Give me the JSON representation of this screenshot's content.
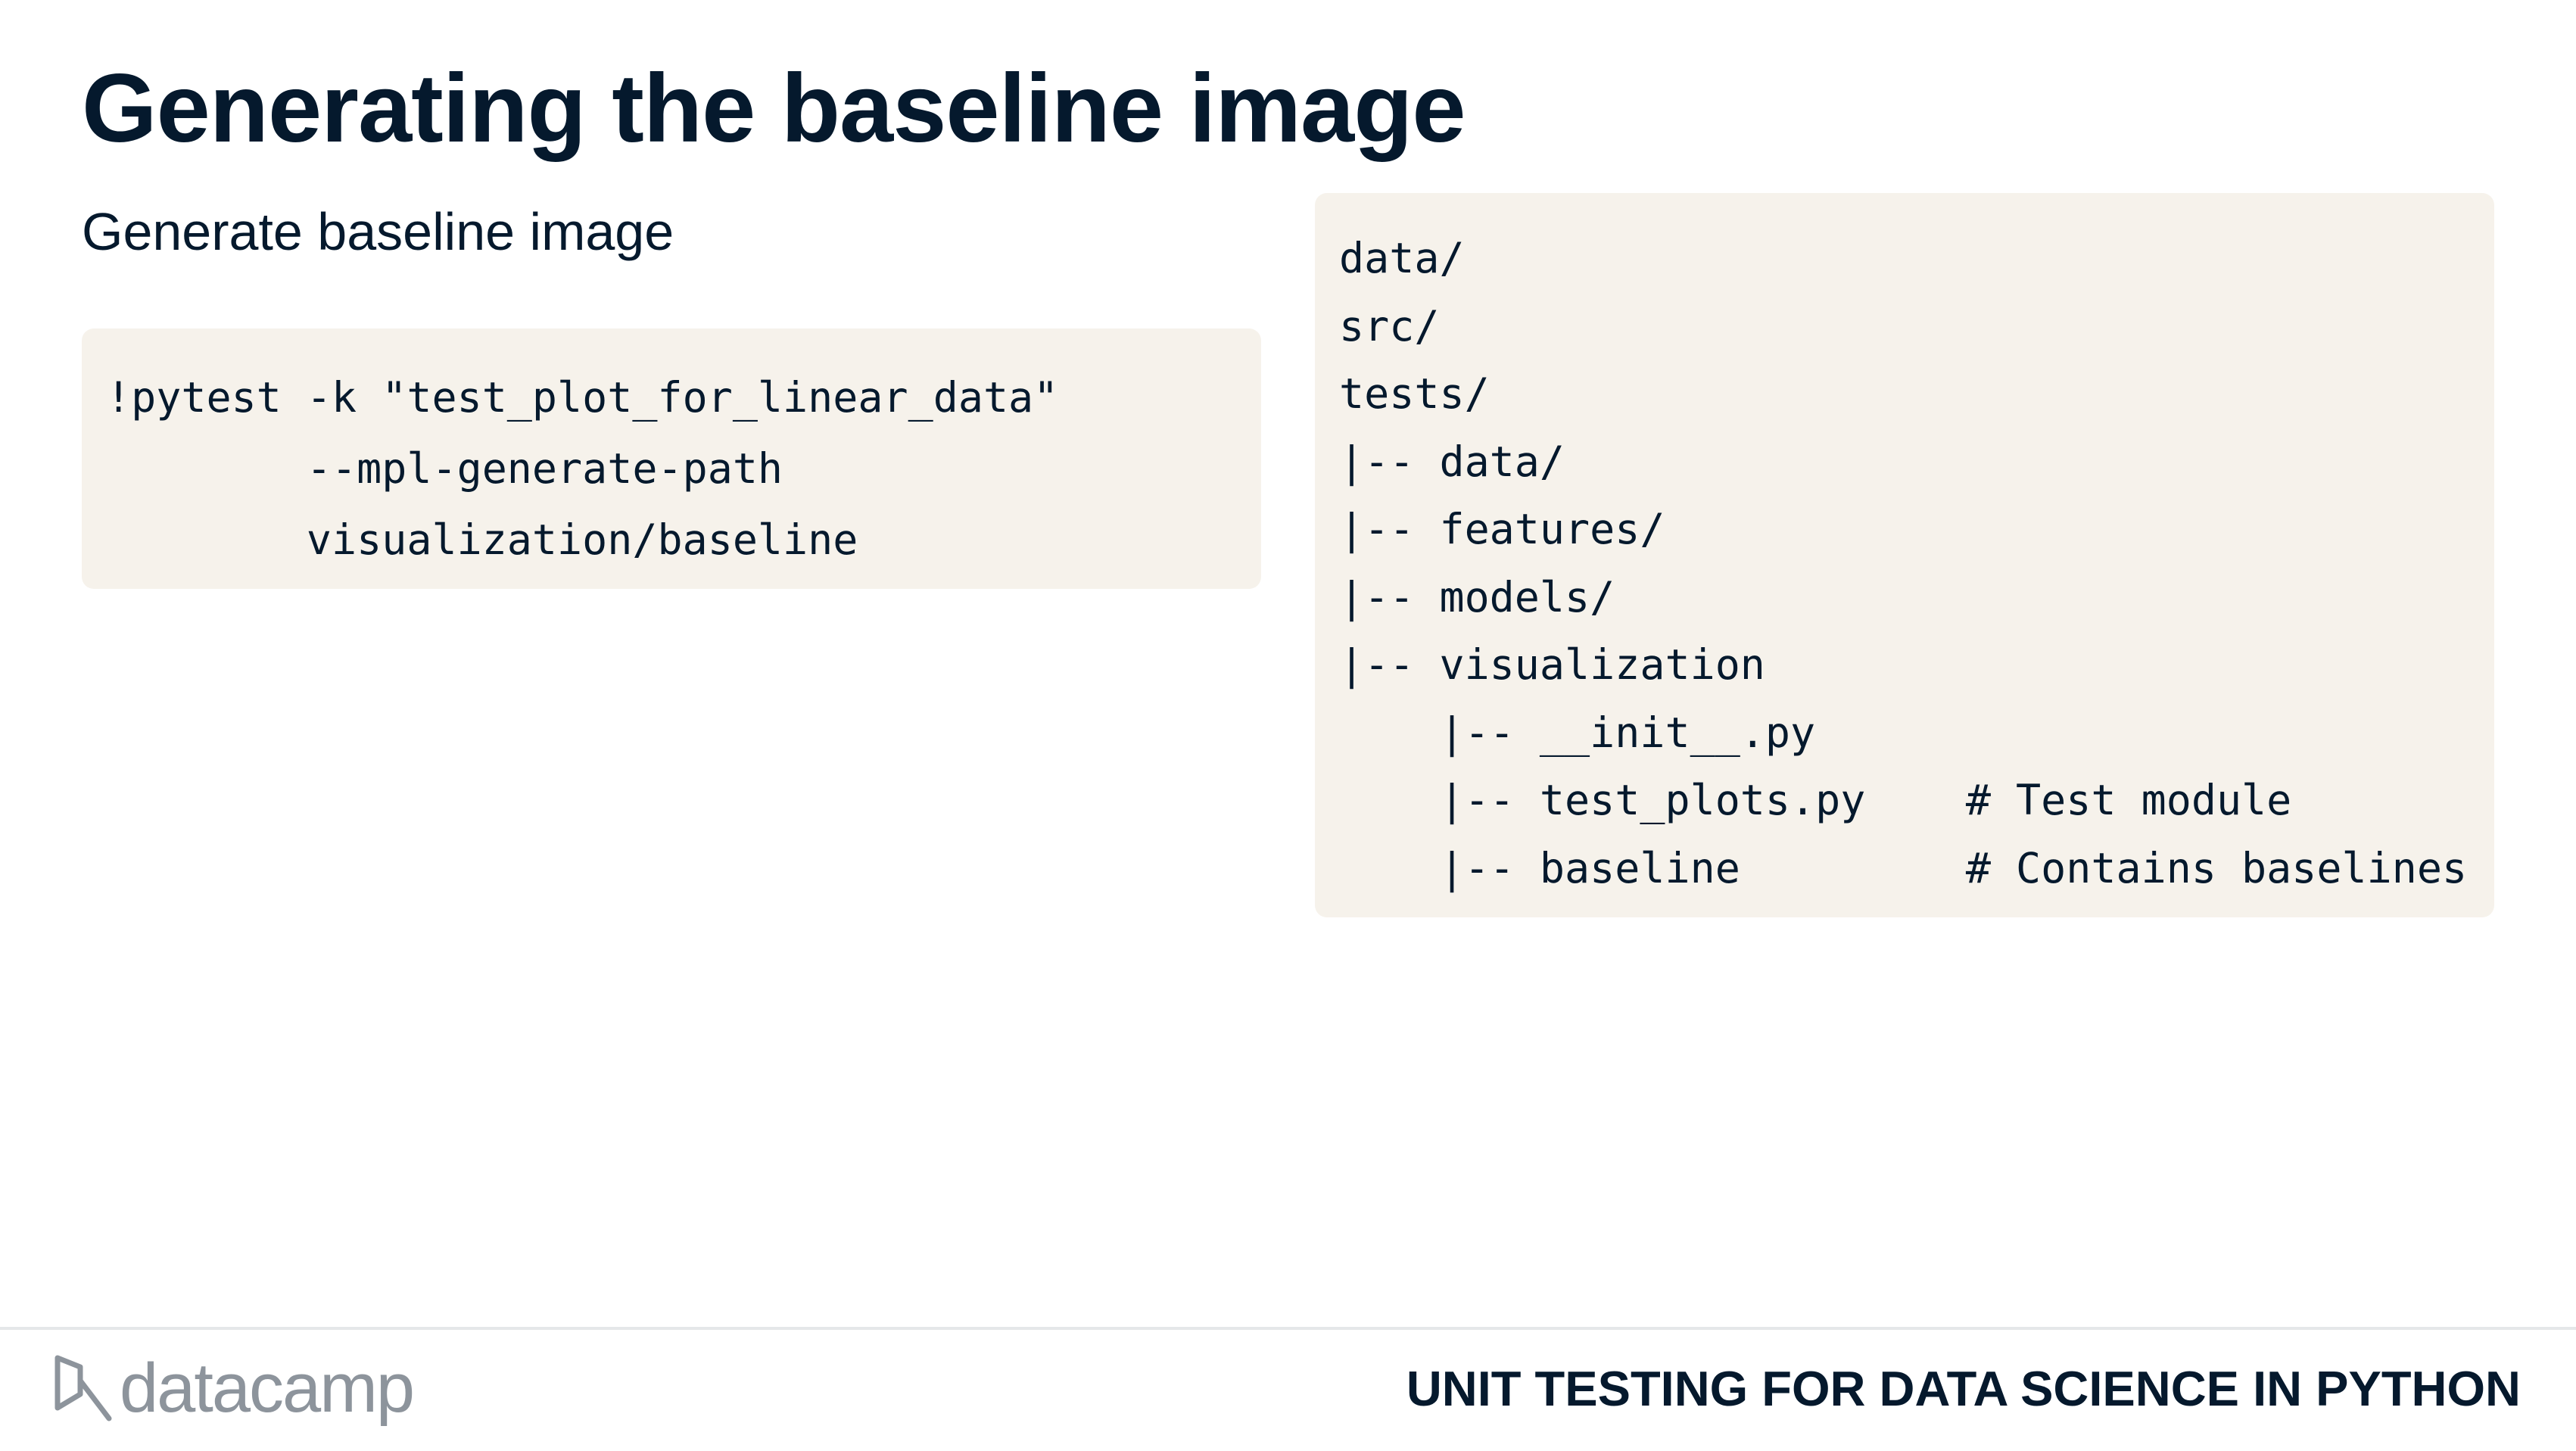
{
  "slide": {
    "title": "Generating the baseline image",
    "subtitle": "Generate baseline image"
  },
  "command_block": {
    "lines": [
      "!pytest -k \"test_plot_for_linear_data\"",
      "        --mpl-generate-path",
      "        visualization/baseline"
    ]
  },
  "tree_block": {
    "lines": [
      "data/",
      "src/",
      "tests/",
      "|-- data/",
      "|-- features/",
      "|-- models/",
      "|-- visualization",
      "    |-- __init__.py",
      "    |-- test_plots.py    # Test module",
      "    |-- baseline         # Contains baselines"
    ]
  },
  "footer": {
    "logo_text": "datacamp",
    "logo_icon": "datacamp-logo-icon",
    "course_title": "UNIT TESTING FOR DATA SCIENCE IN PYTHON"
  },
  "colors": {
    "text": "#05192d",
    "code_background": "#f6f2eb",
    "logo_gray": "#8d949c",
    "divider": "#e5e7e9"
  }
}
